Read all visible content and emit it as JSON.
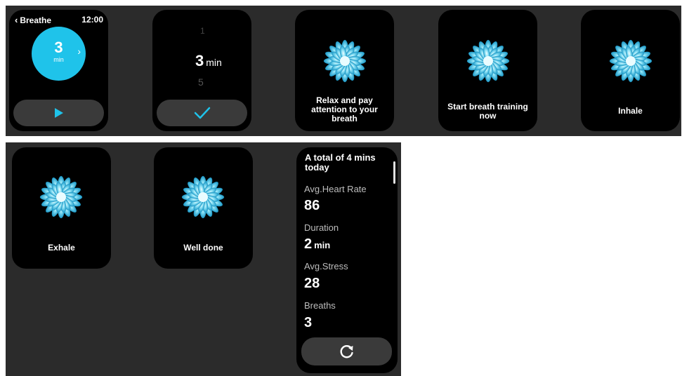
{
  "screens": {
    "start": {
      "back_label": "Breathe",
      "time": "12:00",
      "minutes": "3",
      "unit": "min",
      "play_icon": "play-icon",
      "chevron_icon": "chevron-right-icon"
    },
    "picker": {
      "above": "1",
      "value": "3",
      "unit": "min",
      "below": "5",
      "confirm_icon": "check-icon"
    },
    "relax": {
      "caption": "Relax and pay attention to your breath"
    },
    "start_training": {
      "caption": "Start breath training now"
    },
    "inhale": {
      "caption": "Inhale"
    },
    "exhale": {
      "caption": "Exhale"
    },
    "well_done": {
      "caption": "Well done"
    },
    "summary": {
      "title": "A total of 4 mins today",
      "heart_rate_label": "Avg.Heart Rate",
      "heart_rate_value": "86",
      "duration_label": "Duration",
      "duration_value": "2",
      "duration_unit": "min",
      "stress_label": "Avg.Stress",
      "stress_value": "28",
      "breaths_label": "Breaths",
      "breaths_value": "3",
      "restart_icon": "refresh-icon"
    }
  },
  "colors": {
    "accent": "#1fc3ea",
    "panel": "#2b2b2b",
    "button": "#3a3a3a",
    "flower_inner": "#e6fbff",
    "flower_outer": "#1fa0cf"
  }
}
